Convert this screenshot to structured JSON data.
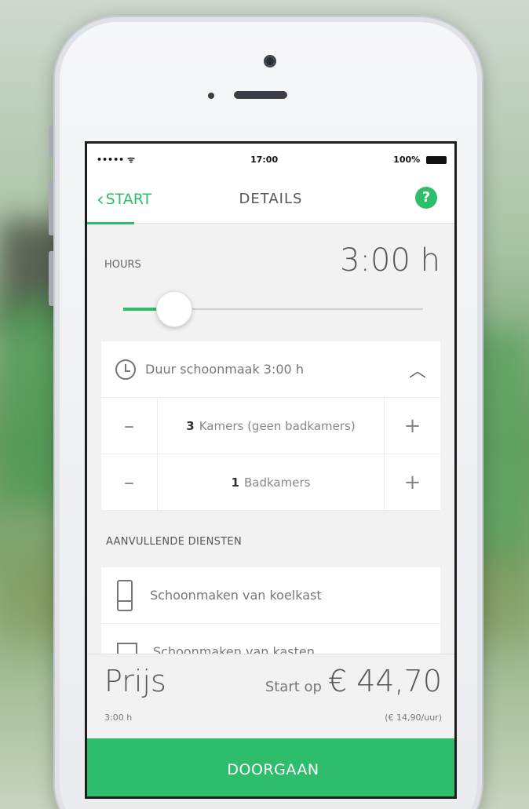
{
  "status_bar": {
    "signal": "••••• ᯤ",
    "time": "17:00",
    "battery": "100%"
  },
  "nav": {
    "back_label": "START",
    "title": "DETAILS",
    "help_label": "?"
  },
  "hours": {
    "label": "HOURS",
    "value": "3:00 h",
    "slider_fraction": 0.14
  },
  "duration": {
    "label": "Duur schoonmaak 3:00 h",
    "expanded": true
  },
  "rooms": {
    "kamers": {
      "count": "3",
      "label": "Kamers (geen badkamers)"
    },
    "badkamers": {
      "count": "1",
      "label": "Badkamers"
    },
    "minus": "–",
    "plus": "+"
  },
  "extras": {
    "title": "AANVULLENDE DIENSTEN",
    "items": [
      {
        "label": "Schoonmaken van koelkast",
        "icon": "fridge-icon"
      },
      {
        "label": "Schoonmaken van kasten",
        "icon": "oven-icon"
      }
    ]
  },
  "price": {
    "label": "Prijs",
    "duration": "3:00 h",
    "start_prefix": "Start op",
    "amount": "€ 44,70",
    "rate": "(€ 14,90/uur)"
  },
  "cta": {
    "label": "DOORGAAN"
  },
  "colors": {
    "accent": "#2ebd6b"
  }
}
